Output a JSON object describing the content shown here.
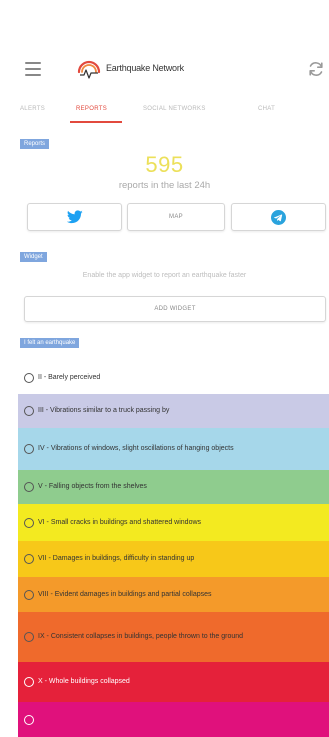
{
  "header": {
    "title": "Earthquake Network"
  },
  "tabs": [
    {
      "label": "ALERTS"
    },
    {
      "label": "REPORTS"
    },
    {
      "label": "SOCIAL NETWORKS"
    },
    {
      "label": "CHAT"
    }
  ],
  "reports": {
    "section_label": "Reports",
    "count": "595",
    "subtitle": "reports in the last 24h",
    "buttons": [
      {
        "icon": "twitter-icon"
      },
      {
        "label": "MAP"
      },
      {
        "icon": "telegram-icon"
      }
    ]
  },
  "widget": {
    "section_label": "Widget",
    "description": "Enable the app widget to report an earthquake faster",
    "button_label": "ADD WIDGET"
  },
  "intensity": {
    "section_label": "I felt an earthquake",
    "items": [
      {
        "label": "II - Barely perceived",
        "color": "#ffffff"
      },
      {
        "label": "III - Vibrations similar to a truck passing by",
        "color": "#c9cae6"
      },
      {
        "label": "IV - Vibrations of windows, slight oscillations of hanging objects",
        "color": "#a6d7ea"
      },
      {
        "label": "V - Falling objects from the shelves",
        "color": "#8fcc8e"
      },
      {
        "label": "VI - Small cracks in buildings and shattered windows",
        "color": "#f3ea20"
      },
      {
        "label": "VII - Damages in buildings, difficulty in standing up",
        "color": "#f7c819"
      },
      {
        "label": "VIII - Evident damages in buildings and partial collapses",
        "color": "#f49a2a"
      },
      {
        "label": "IX - Consistent collapses in buildings, people thrown to the ground",
        "color": "#ef6a2c"
      },
      {
        "label": "X - Whole buildings collapsed",
        "color": "#e5213a"
      },
      {
        "label": "",
        "color": "#e0117c"
      }
    ]
  },
  "colors": {
    "accent": "#e24a3e",
    "section_label_bg": "#7fa6de",
    "twitter": "#1da1f2",
    "telegram": "#2aa3dd",
    "count": "#ece05a"
  }
}
